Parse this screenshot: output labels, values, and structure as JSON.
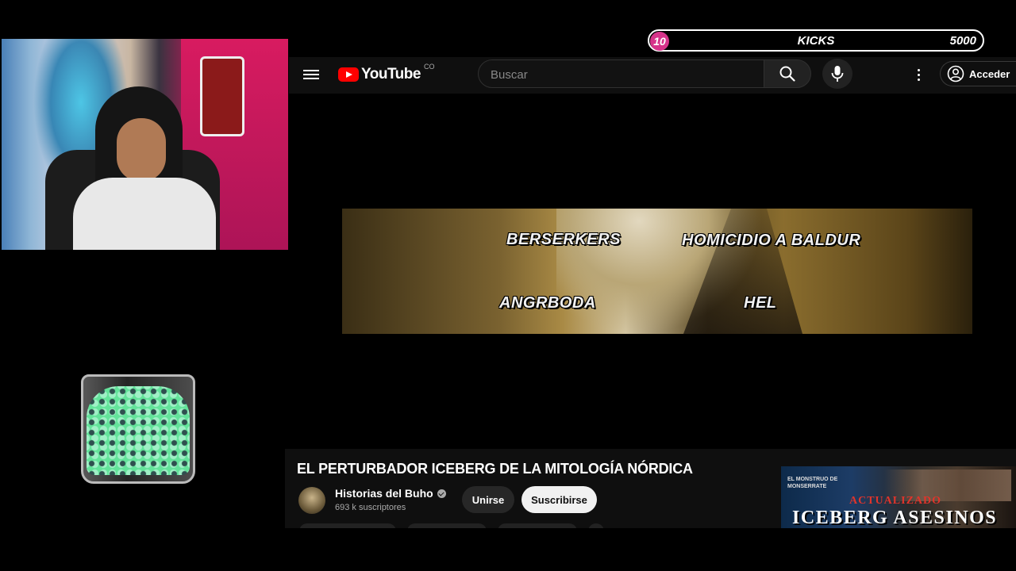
{
  "kicks": {
    "count": "10",
    "label": "KICKS",
    "goal": "5000"
  },
  "header": {
    "logo_text": "YouTube",
    "country_code": "CO",
    "search_placeholder": "Buscar",
    "signin_label": "Acceder"
  },
  "video_overlay": {
    "labels": [
      "BERSERKERS",
      "HOMICIDIO A BALDUR",
      "ANGRBODA",
      "HEL"
    ]
  },
  "video_info": {
    "title": "EL PERTURBADOR ICEBERG DE LA MITOLOGÍA NÓRDICA",
    "channel_name": "Historias del Buho",
    "subscribers": "693 k suscriptores",
    "join_label": "Unirse",
    "subscribe_label": "Suscribirse"
  },
  "thumbnail": {
    "small_text_1": "EL MONSTRUO DE",
    "small_text_2": "MONSERRATE",
    "updated_label": "ACTUALIZADO",
    "title": "ICEBERG ASESINOS"
  },
  "colors": {
    "youtube_red": "#ff0000",
    "kicks_badge": "#d6338a",
    "jar_fill": "#63e39a"
  }
}
